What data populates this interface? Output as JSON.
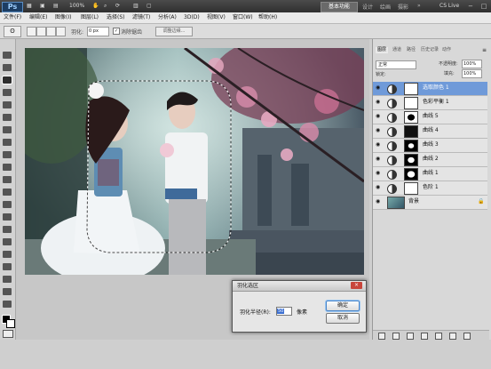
{
  "app": {
    "logo": "Ps",
    "zoom": "100%",
    "workspace_label": "基本功能",
    "workspace_items": [
      "设计",
      "绘画",
      "摄影"
    ],
    "cs_live": "CS Live",
    "window_controls": [
      "−",
      "□",
      "×"
    ]
  },
  "menu": {
    "items": [
      "文件(F)",
      "编辑(E)",
      "图像(I)",
      "图层(L)",
      "选择(S)",
      "滤镜(T)",
      "分析(A)",
      "3D(D)",
      "视图(V)",
      "窗口(W)",
      "帮助(H)"
    ]
  },
  "options": {
    "feather_label": "羽化:",
    "feather_value": "0 px",
    "antialias_label": "消除锯齿",
    "antialias_checked": true,
    "refine_edge": "调整边缘..."
  },
  "panels": {
    "tabs": [
      "图层",
      "通道",
      "路径",
      "历史记录",
      "动作"
    ],
    "blend_mode": "正常",
    "opacity_label": "不透明度:",
    "opacity": "100%",
    "lock_label": "锁定:",
    "fill_label": "填充:",
    "fill": "100%",
    "layers": [
      {
        "name": "选取颜色 1",
        "selected": true
      },
      {
        "name": "色彩平衡 1",
        "selected": false
      },
      {
        "name": "曲线 5",
        "selected": false
      },
      {
        "name": "曲线 4",
        "selected": false
      },
      {
        "name": "曲线 3",
        "selected": false
      },
      {
        "name": "曲线 2",
        "selected": false
      },
      {
        "name": "曲线 1",
        "selected": false
      },
      {
        "name": "色阶 1",
        "selected": false
      },
      {
        "name": "背景",
        "selected": false
      }
    ]
  },
  "dialog": {
    "title": "羽化选区",
    "close": "×",
    "radius_label": "羽化半径(R):",
    "radius_value": "50",
    "unit": "像素",
    "ok": "确定",
    "cancel": "取消"
  },
  "colors": {
    "selected_layer": "#6f9ad9",
    "dialog_close": "#c8453b"
  }
}
